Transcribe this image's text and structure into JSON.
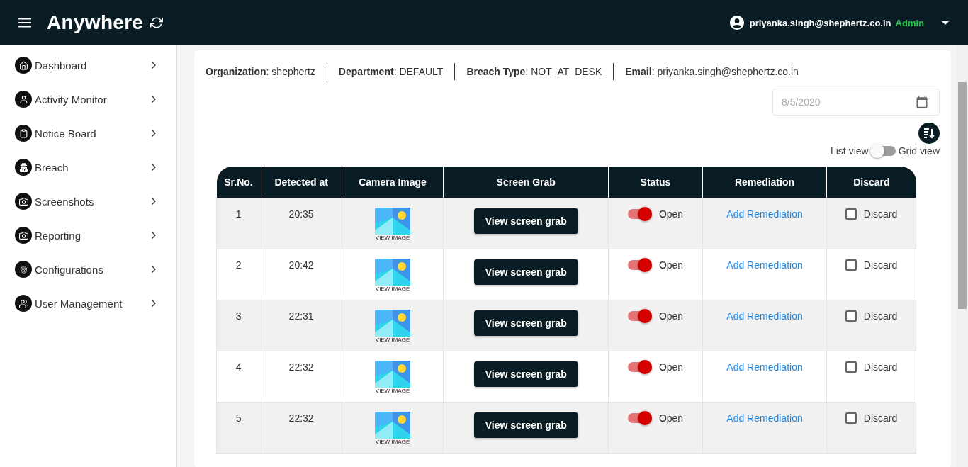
{
  "header": {
    "logo": "Anywhere",
    "user_email": "priyanka.singh@shephertz.co.in",
    "role": "Admin"
  },
  "sidebar": {
    "items": [
      {
        "label": "Dashboard",
        "kind": "home"
      },
      {
        "label": "Activity Monitor",
        "kind": "person"
      },
      {
        "label": "Notice Board",
        "kind": "clipboard"
      },
      {
        "label": "Breach",
        "kind": "agent"
      },
      {
        "label": "Screenshots",
        "kind": "camera"
      },
      {
        "label": "Reporting",
        "kind": "camera"
      },
      {
        "label": "Configurations",
        "kind": "fingerprint"
      },
      {
        "label": "User Management",
        "kind": "people"
      }
    ]
  },
  "info": [
    "**Organization**: shephertz",
    "**Department**: DEFAULT",
    "**Breach Type**: NOT_AT_DESK",
    "**Email**: priyanka.singh@shephertz.co.in"
  ],
  "date_field": {
    "placeholder": "8/5/2020"
  },
  "view_toggle": {
    "left_label": "List view",
    "right_label": "Grid view",
    "on": false
  },
  "table": {
    "columns": [
      "Sr.No.",
      "Detected at",
      "Camera Image",
      "Screen Grab",
      "Status",
      "Remediation",
      "Discard"
    ],
    "rows": [
      {
        "sr": "1",
        "time": "20:35",
        "image_caption": "VIEW IMAGE",
        "button": "View screen grab",
        "status": "Open",
        "status_on": true,
        "remediation": "Add Remediation",
        "discard": "Discard",
        "checked": false
      },
      {
        "sr": "2",
        "time": "20:42",
        "image_caption": "VIEW IMAGE",
        "button": "View screen grab",
        "status": "Open",
        "status_on": true,
        "remediation": "Add Remediation",
        "discard": "Discard",
        "checked": false
      },
      {
        "sr": "3",
        "time": "22:31",
        "image_caption": "VIEW IMAGE",
        "button": "View screen grab",
        "status": "Open",
        "status_on": true,
        "remediation": "Add Remediation",
        "discard": "Discard",
        "checked": false
      },
      {
        "sr": "4",
        "time": "22:32",
        "image_caption": "VIEW IMAGE",
        "button": "View screen grab",
        "status": "Open",
        "status_on": true,
        "remediation": "Add Remediation",
        "discard": "Discard",
        "checked": false
      },
      {
        "sr": "5",
        "time": "22:32",
        "image_caption": "VIEW IMAGE",
        "button": "View screen grab",
        "status": "Open",
        "status_on": true,
        "remediation": "Add Remediation",
        "discard": "Discard",
        "checked": false
      }
    ]
  }
}
